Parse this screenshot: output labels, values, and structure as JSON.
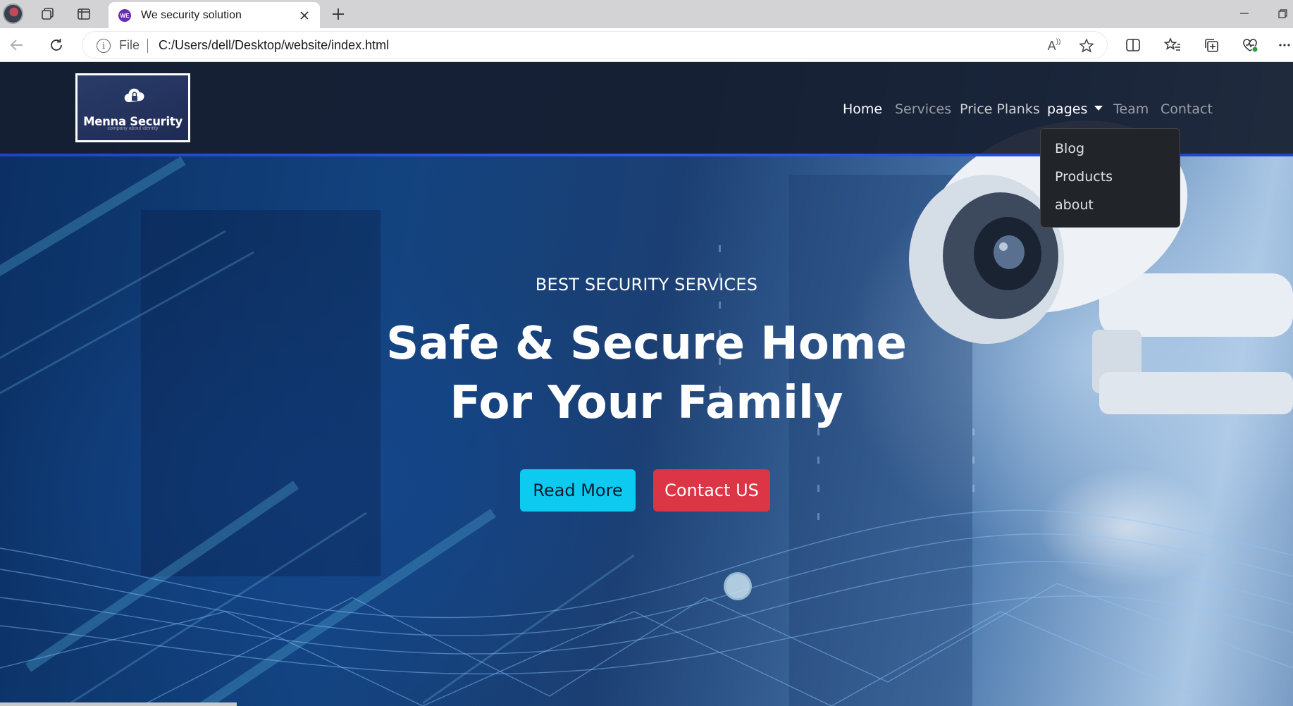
{
  "browser": {
    "tab_title": "We security solution",
    "tab_favicon_text": "WE",
    "address_scheme_label": "File",
    "address_url": "C:/Users/dell/Desktop/website/index.html",
    "read_aloud_label": "A"
  },
  "site": {
    "brand_name": "Menna Security",
    "brand_tagline": "company about identity",
    "nav": {
      "home": "Home",
      "services": "Services",
      "price_planks": "Price Planks",
      "pages": "pages",
      "team": "Team",
      "contact": "Contact"
    },
    "dropdown": [
      "Blog",
      "Products",
      "about"
    ],
    "hero": {
      "subtitle": "BEST SECURITY SERVICES",
      "title_line1": "Safe & Secure Home",
      "title_line2": "For Your Family",
      "read_more": "Read More",
      "contact_us": "Contact US"
    }
  },
  "colors": {
    "nav_bg": "#161e30",
    "nav_accent_line": "#2a5bf0",
    "dropdown_bg": "#212529",
    "btn_read_more": "#0dcaf0",
    "btn_contact": "#dc3545"
  }
}
